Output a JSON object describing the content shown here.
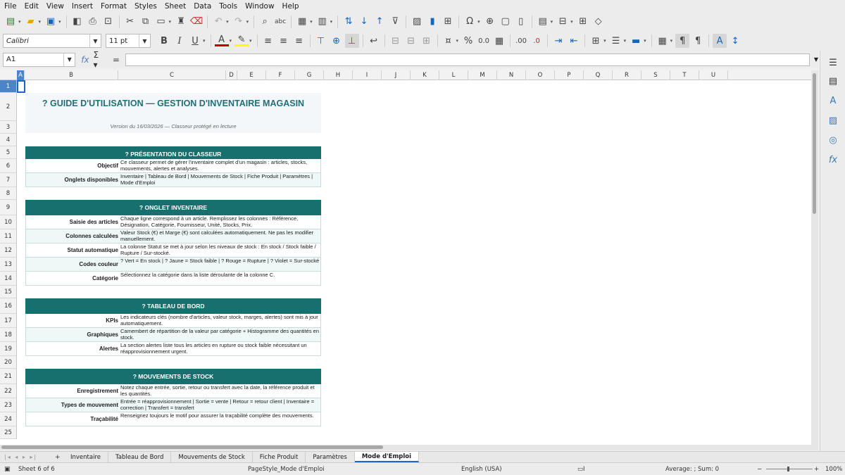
{
  "menu": [
    "File",
    "Edit",
    "View",
    "Insert",
    "Format",
    "Styles",
    "Sheet",
    "Data",
    "Tools",
    "Window",
    "Help"
  ],
  "font": {
    "name": "Calibri",
    "size": "11 pt"
  },
  "name_box": "A1",
  "columns": [
    "A",
    "B",
    "C",
    "D",
    "E",
    "F",
    "G",
    "H",
    "I",
    "J",
    "K",
    "L",
    "M",
    "N",
    "O",
    "P",
    "Q",
    "R",
    "S",
    "T",
    "U"
  ],
  "rows": [
    "1",
    "2",
    "3",
    "4",
    "5",
    "6",
    "7",
    "8",
    "9",
    "10",
    "11",
    "12",
    "13",
    "14",
    "15",
    "16",
    "17",
    "18",
    "19",
    "20",
    "21",
    "22",
    "23",
    "24",
    "25"
  ],
  "doc": {
    "title": "? GUIDE D'UTILISATION — GESTION D'INVENTAIRE MAGASIN",
    "subtitle": "Version du 16/03/2026 — Classeur protégé en lecture",
    "sections": [
      {
        "header": "? PRÉSENTATION DU CLASSEUR",
        "rows": [
          {
            "label": "Objectif",
            "text": "Ce classeur permet de gérer l'inventaire complet d'un magasin : articles, stocks, mouvements, alertes et analyses."
          },
          {
            "label": "Onglets disponibles",
            "text": "Inventaire | Tableau de Bord | Mouvements de Stock | Fiche Produit | Paramètres | Mode d'Emploi"
          }
        ]
      },
      {
        "header": "? ONGLET INVENTAIRE",
        "rows": [
          {
            "label": "Saisie des articles",
            "text": "Chaque ligne correspond à un article. Remplissez les colonnes : Référence, Désignation, Catégorie, Fournisseur, Unité, Stocks, Prix."
          },
          {
            "label": "Colonnes calculées",
            "text": "Valeur Stock (€) et Marge (€) sont calculées automatiquement. Ne pas les modifier manuellement."
          },
          {
            "label": "Statut automatique",
            "text": "La colonne Statut se met à jour selon les niveaux de stock : En stock / Stock faible / Rupture / Sur-stocké."
          },
          {
            "label": "Codes couleur",
            "text": "? Vert = En stock | ? Jaune = Stock faible | ? Rouge = Rupture | ? Violet = Sur-stocké"
          },
          {
            "label": "Catégorie",
            "text": "Sélectionnez la catégorie dans la liste déroulante de la colonne C."
          }
        ]
      },
      {
        "header": "? TABLEAU DE BORD",
        "rows": [
          {
            "label": "KPIs",
            "text": "Les indicateurs clés (nombre d'articles, valeur stock, marges, alertes) sont mis à jour automatiquement."
          },
          {
            "label": "Graphiques",
            "text": "Camembert de répartition de la valeur par catégorie + Histogramme des quantités en stock."
          },
          {
            "label": "Alertes",
            "text": "La section alertes liste tous les articles en rupture ou stock faible nécessitant un réapprovisionnement urgent."
          }
        ]
      },
      {
        "header": "? MOUVEMENTS DE STOCK",
        "rows": [
          {
            "label": "Enregistrement",
            "text": "Notez chaque entrée, sortie, retour ou transfert avec la date, la référence produit et les quantités."
          },
          {
            "label": "Types de mouvement",
            "text": "Entrée = réapprovisionnement | Sortie = vente | Retour = retour client | Inventaire = correction | Transfert = transfert"
          },
          {
            "label": "Traçabilité",
            "text": "Renseignez toujours le motif pour assurer la traçabilité complète des mouvements."
          }
        ]
      }
    ]
  },
  "tabs": [
    "Inventaire",
    "Tableau de Bord",
    "Mouvements de Stock",
    "Fiche Produit",
    "Paramètres",
    "Mode d'Emploi"
  ],
  "active_tab": "Mode d'Emploi",
  "status": {
    "sheet": "Sheet 6 of 6",
    "page_style": "PageStyle_Mode d'Emploi",
    "language": "English (USA)",
    "sum": "Average: ; Sum: 0",
    "zoom": "100%"
  },
  "colors": {
    "header_fill": "#17706e",
    "title_text": "#1f6f7a",
    "alt_row": "#eef8f6",
    "selection": "#4a86c7"
  }
}
